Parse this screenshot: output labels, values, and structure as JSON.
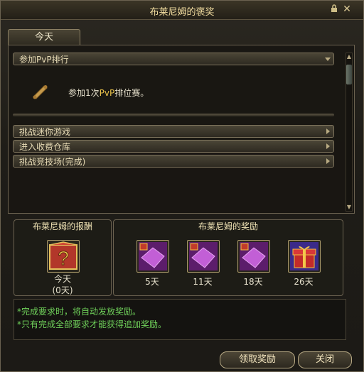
{
  "window": {
    "title": "布莱尼姆的褒奖",
    "lock_icon": "lock-icon",
    "close_icon": "close-icon"
  },
  "tabs": [
    {
      "label": "今天",
      "selected": true
    }
  ],
  "quest_list": {
    "rows": [
      {
        "label": "参加PvP排行",
        "expanded": true
      },
      {
        "label": "挑战迷你游戏",
        "expanded": false
      },
      {
        "label": "进入收费仓库",
        "expanded": false
      },
      {
        "label": "挑战竞技场(完成)",
        "expanded": false
      }
    ],
    "detail": {
      "icon": "scroll-icon",
      "prefix": "参加1次",
      "highlight": "PvP",
      "suffix": "排位赛。"
    }
  },
  "current_reward": {
    "title": "布莱尼姆的报酬",
    "icon": "mystery-box-icon",
    "label_day": "今天",
    "label_count": "(0天)"
  },
  "bonus_rewards": {
    "title": "布莱尼姆的奖励",
    "items": [
      {
        "icon": "locked-purple-box-icon",
        "label": "5天"
      },
      {
        "icon": "locked-purple-box-icon",
        "label": "11天"
      },
      {
        "icon": "locked-purple-box-icon",
        "label": "18天"
      },
      {
        "icon": "red-gift-box-icon",
        "label": "26天"
      }
    ]
  },
  "notes": [
    "*完成要求时，将自动发放奖励。",
    "*只有完成全部要求才能获得追加奖励。"
  ],
  "buttons": {
    "claim": "领取奖励",
    "close": "关闭"
  },
  "colors": {
    "accent_gold": "#e8c14a",
    "note_green": "#6fd05a",
    "title_text": "#f2dda0"
  }
}
